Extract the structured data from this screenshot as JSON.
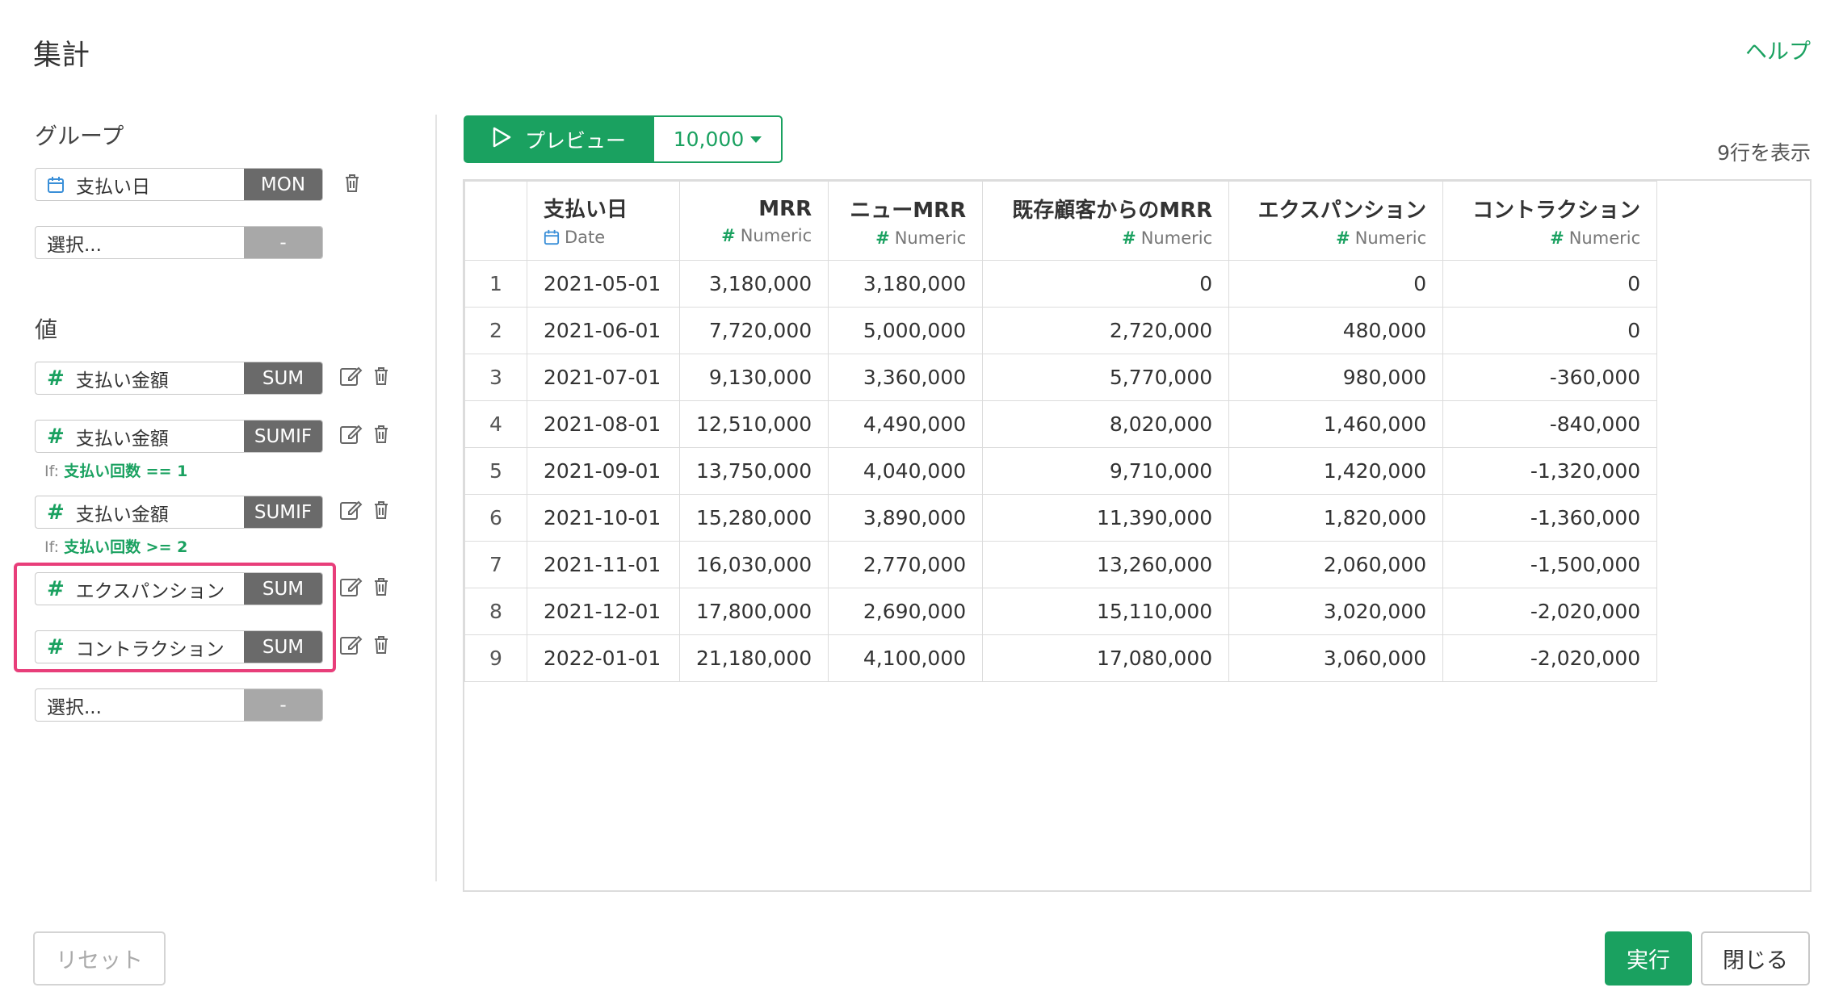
{
  "header": {
    "title": "集計",
    "help_link": "ヘルプ"
  },
  "group_section": {
    "label": "グループ",
    "items": [
      {
        "name": "支払い日",
        "type_icon": "calendar-icon",
        "agg": "MON"
      },
      {
        "name": "選択...",
        "agg": "-"
      }
    ]
  },
  "value_section": {
    "label": "値",
    "items": [
      {
        "name": "支払い金額",
        "type_icon": "hash",
        "agg": "SUM"
      },
      {
        "name": "支払い金額",
        "type_icon": "hash",
        "agg": "SUMIF",
        "cond_prefix": "If: ",
        "cond_expr": "支払い回数 == 1"
      },
      {
        "name": "支払い金額",
        "type_icon": "hash",
        "agg": "SUMIF",
        "cond_prefix": "If: ",
        "cond_expr": "支払い回数 >= 2"
      },
      {
        "name": "エクスパンション",
        "type_icon": "hash",
        "agg": "SUM"
      },
      {
        "name": "コントラクション",
        "type_icon": "hash",
        "agg": "SUM"
      },
      {
        "name": "選択...",
        "agg": "-"
      }
    ]
  },
  "toolbar": {
    "preview_label": "プレビュー",
    "limit_value": "10,000",
    "row_count": "9行を表示"
  },
  "table": {
    "columns": [
      {
        "name": "支払い日",
        "type": "Date"
      },
      {
        "name": "MRR",
        "type": "Numeric"
      },
      {
        "name": "ニューMRR",
        "type": "Numeric"
      },
      {
        "name": "既存顧客からのMRR",
        "type": "Numeric"
      },
      {
        "name": "エクスパンション",
        "type": "Numeric"
      },
      {
        "name": "コントラクション",
        "type": "Numeric"
      }
    ],
    "rows": [
      [
        "1",
        "2021-05-01",
        "3,180,000",
        "3,180,000",
        "0",
        "0",
        "0"
      ],
      [
        "2",
        "2021-06-01",
        "7,720,000",
        "5,000,000",
        "2,720,000",
        "480,000",
        "0"
      ],
      [
        "3",
        "2021-07-01",
        "9,130,000",
        "3,360,000",
        "5,770,000",
        "980,000",
        "-360,000"
      ],
      [
        "4",
        "2021-08-01",
        "12,510,000",
        "4,490,000",
        "8,020,000",
        "1,460,000",
        "-840,000"
      ],
      [
        "5",
        "2021-09-01",
        "13,750,000",
        "4,040,000",
        "9,710,000",
        "1,420,000",
        "-1,320,000"
      ],
      [
        "6",
        "2021-10-01",
        "15,280,000",
        "3,890,000",
        "11,390,000",
        "1,820,000",
        "-1,360,000"
      ],
      [
        "7",
        "2021-11-01",
        "16,030,000",
        "2,770,000",
        "13,260,000",
        "2,060,000",
        "-1,500,000"
      ],
      [
        "8",
        "2021-12-01",
        "17,800,000",
        "2,690,000",
        "15,110,000",
        "3,020,000",
        "-2,020,000"
      ],
      [
        "9",
        "2022-01-01",
        "21,180,000",
        "4,100,000",
        "17,080,000",
        "3,060,000",
        "-2,020,000"
      ]
    ]
  },
  "footer": {
    "reset_label": "リセット",
    "run_label": "実行",
    "close_label": "閉じる"
  },
  "colors": {
    "accent": "#1aa160",
    "highlight": "#e83e7a",
    "agg_bg": "#6a6a6a"
  }
}
